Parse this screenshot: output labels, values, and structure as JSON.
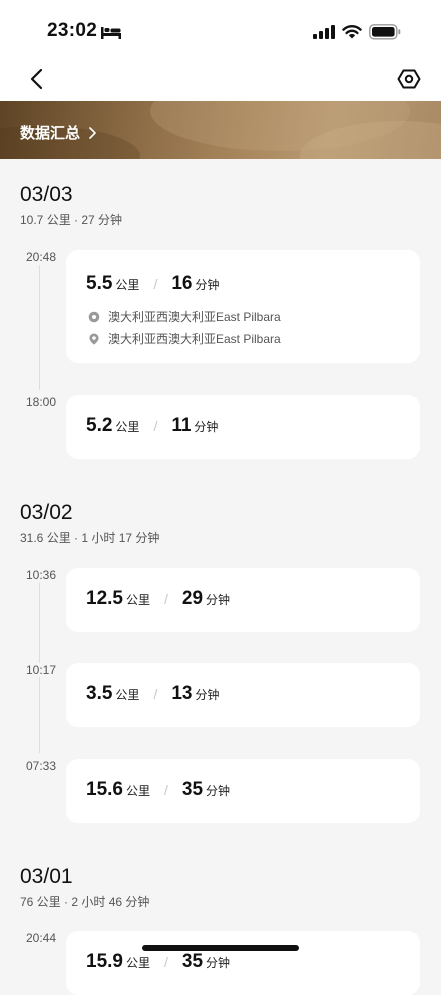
{
  "status_bar": {
    "time": "23:02"
  },
  "banner": {
    "label": "数据汇总"
  },
  "days": [
    {
      "date": "03/03",
      "summary": "10.7 公里 · 27 分钟",
      "entries": [
        {
          "time": "20:48",
          "distance": "5.5",
          "distance_unit": "公里",
          "duration": "16",
          "duration_unit": "分钟",
          "start_location": "澳大利亚西澳大利亚East Pilbara",
          "end_location": "澳大利亚西澳大利亚East Pilbara"
        },
        {
          "time": "18:00",
          "distance": "5.2",
          "distance_unit": "公里",
          "duration": "11",
          "duration_unit": "分钟"
        }
      ]
    },
    {
      "date": "03/02",
      "summary": "31.6 公里 · 1 小时 17 分钟",
      "entries": [
        {
          "time": "10:36",
          "distance": "12.5",
          "distance_unit": "公里",
          "duration": "29",
          "duration_unit": "分钟"
        },
        {
          "time": "10:17",
          "distance": "3.5",
          "distance_unit": "公里",
          "duration": "13",
          "duration_unit": "分钟"
        },
        {
          "time": "07:33",
          "distance": "15.6",
          "distance_unit": "公里",
          "duration": "35",
          "duration_unit": "分钟"
        }
      ]
    },
    {
      "date": "03/01",
      "summary": "76 公里 · 2 小时 46 分钟",
      "entries": [
        {
          "time": "20:44",
          "distance": "15.9",
          "distance_unit": "公里",
          "duration": "35",
          "duration_unit": "分钟"
        }
      ]
    }
  ],
  "separator": "/"
}
